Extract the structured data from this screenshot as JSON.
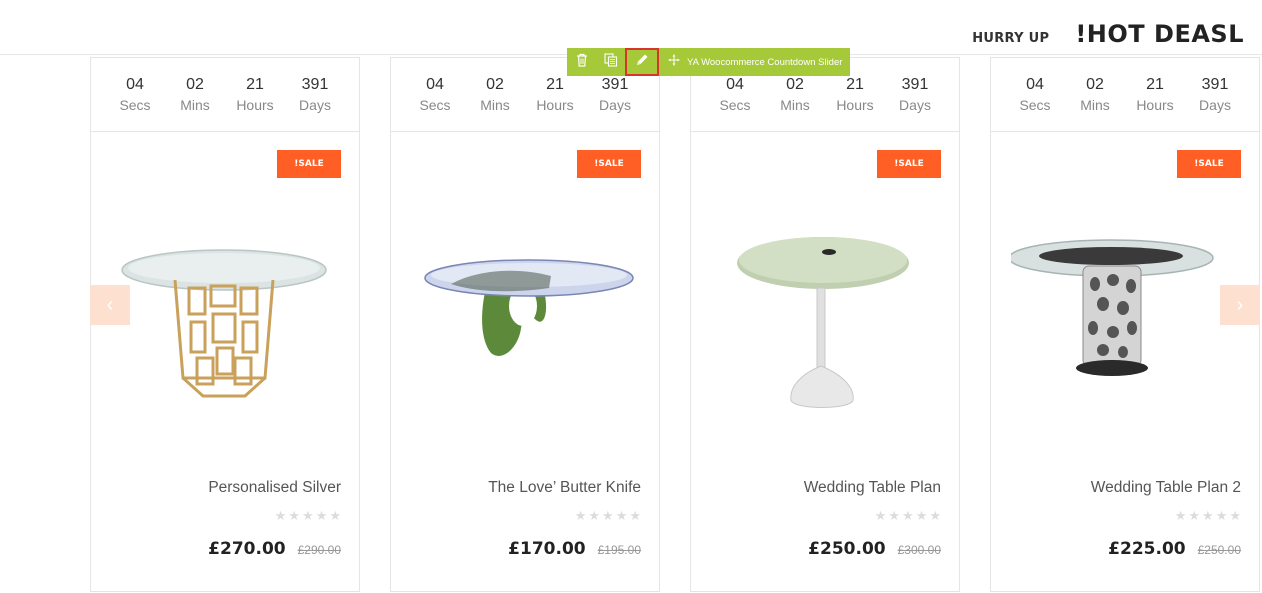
{
  "header": {
    "hurry_up": "HURRY UP",
    "title": "!HOT DEASL"
  },
  "toolbar": {
    "label": "YA Woocommerce Countdown Slider",
    "buttons": [
      "trash-icon",
      "copy-icon",
      "pencil-icon",
      "move-icon"
    ],
    "color": "#a6c93a",
    "active_outline": "#d9342b"
  },
  "nav": {
    "prev": "‹",
    "next": "›",
    "color": "#fde0cf"
  },
  "sale_color": "#ff5e24",
  "products": [
    {
      "countdown": [
        {
          "value": "04",
          "label": "Secs"
        },
        {
          "value": "02",
          "label": "Mins"
        },
        {
          "value": "21",
          "label": "Hours"
        },
        {
          "value": "391",
          "label": "Days"
        }
      ],
      "badge": "!SALE",
      "name": "Personalised Silver",
      "rating": 0,
      "price": "£270.00",
      "old_price": "£290.00"
    },
    {
      "countdown": [
        {
          "value": "04",
          "label": "Secs"
        },
        {
          "value": "02",
          "label": "Mins"
        },
        {
          "value": "21",
          "label": "Hours"
        },
        {
          "value": "391",
          "label": "Days"
        }
      ],
      "badge": "!SALE",
      "name": "The Love’ Butter Knife",
      "rating": 0,
      "price": "£170.00",
      "old_price": "£195.00"
    },
    {
      "countdown": [
        {
          "value": "04",
          "label": "Secs"
        },
        {
          "value": "02",
          "label": "Mins"
        },
        {
          "value": "21",
          "label": "Hours"
        },
        {
          "value": "391",
          "label": "Days"
        }
      ],
      "badge": "!SALE",
      "name": "Wedding Table Plan",
      "rating": 0,
      "price": "£250.00",
      "old_price": "£300.00"
    },
    {
      "countdown": [
        {
          "value": "04",
          "label": "Secs"
        },
        {
          "value": "02",
          "label": "Mins"
        },
        {
          "value": "21",
          "label": "Hours"
        },
        {
          "value": "391",
          "label": "Days"
        }
      ],
      "badge": "!SALE",
      "name": "Wedding Table Plan 2",
      "rating": 0,
      "price": "£225.00",
      "old_price": "£250.00"
    }
  ]
}
